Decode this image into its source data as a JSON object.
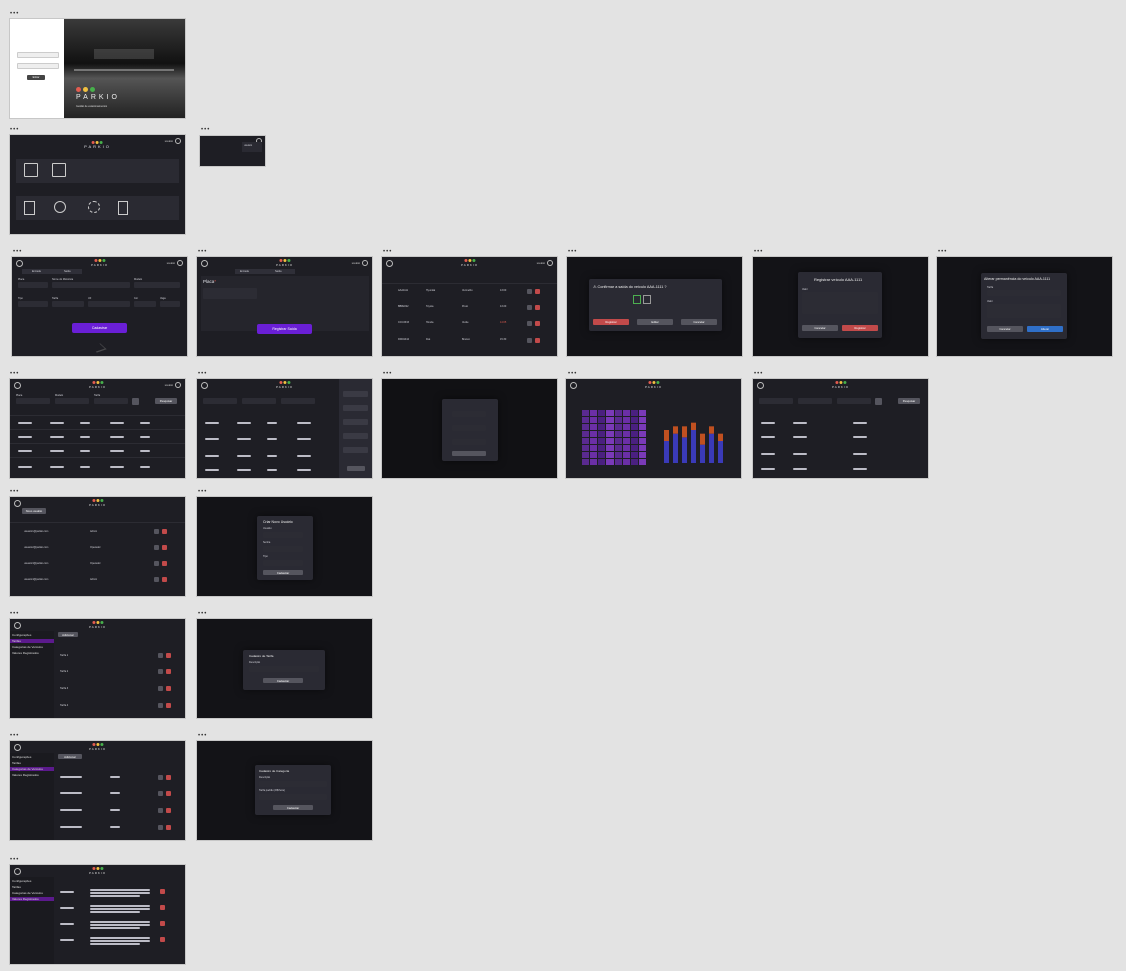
{
  "frame_menu_glyph": "•••",
  "login": {
    "brand": "PARKIO",
    "tagline": "Gestão de estacionamentos",
    "button": "Entrar"
  },
  "menu": {
    "brand": "PARKIO"
  },
  "user": {
    "name": "usuário"
  },
  "entrada": {
    "tabs": [
      "Entrada",
      "Saída"
    ],
    "fields": [
      "Placa",
      "Nome do Motorista",
      "Modelo",
      "Tipo",
      "Tarifa",
      "UF",
      "Cor",
      "Vaga"
    ],
    "button": "Cadastrar"
  },
  "saida": {
    "tabs": [
      "Entrada",
      "Saída"
    ],
    "placa_label": "Placa",
    "required": "*",
    "button": "Registrar Saída"
  },
  "veiculos_table": {
    "rows": [
      [
        "AAA1111",
        "Hyundai",
        "Vermelho",
        "13:00"
      ],
      [
        "BBB2222",
        "Toyota",
        "Preto",
        "13:20"
      ],
      [
        "CCC3333",
        "Honda",
        "Verde",
        "14:05"
      ],
      [
        "DDD4444",
        "Fiat",
        "Branco",
        "15:30"
      ]
    ]
  },
  "confirm_modal": {
    "title": "Confirmar a saída do veículo AAA-1111 ?",
    "buttons": [
      "Registrar",
      "Editar",
      "Cancelar"
    ]
  },
  "registrar_modal": {
    "title": "Registrar veículo AAA-1111",
    "field": "Valor",
    "buttons": [
      "Cancelar",
      "Registrar"
    ]
  },
  "alterar_modal": {
    "title": "Alterar permanência do veículo AAA-1111",
    "fields": [
      "Tarifa",
      "Valor"
    ],
    "buttons": [
      "Cancelar",
      "Alterar"
    ]
  },
  "relatorio": {
    "filters": [
      "Placa",
      "Modelo",
      "Tarifa"
    ],
    "search_button": "Pesquisar",
    "filter_icon": "funnel-icon"
  },
  "usuarios": {
    "add_button": "Novo usuário",
    "rows": [
      "usuario1@parkio.com",
      "usuario2@parkio.com",
      "usuario3@parkio.com",
      "usuario4@parkio.com"
    ],
    "roles": [
      "Admin",
      "Operador",
      "Operador",
      "Admin"
    ],
    "modal_title": "Criar Novo Usuário",
    "modal_fields": [
      "Usuário",
      "Senha",
      "Tipo"
    ],
    "modal_button": "Cadastrar"
  },
  "config": {
    "side_title": "Configurações",
    "side_items": [
      "Tarifas",
      "Categorias de Veículos",
      "Valores Registrados"
    ],
    "add_button": "Adicionar",
    "tarifa_rows": [
      "Tarifa 1",
      "Tarifa 2",
      "Tarifa 3",
      "Tarifa 4"
    ],
    "modal_title": "Cadastro de Tarifa",
    "modal_field": "Descrição",
    "modal_button": "Cadastrar",
    "cat_modal_title": "Cadastro de Categoria",
    "cat_modal_fields": [
      "Descrição",
      "Tarifa padrão (R$/hora)"
    ]
  },
  "colors": {
    "accent": "#6a1fd6",
    "danger": "#c24a4a",
    "bg": "#1e1e24",
    "canvas": "#e3e3e3"
  },
  "chart_data": {
    "type": "bar",
    "series": [
      {
        "values": [
          6,
          8,
          7,
          9,
          5,
          8,
          6
        ]
      },
      {
        "values": [
          3,
          2,
          3,
          2,
          3,
          2,
          2
        ]
      }
    ],
    "colors": [
      "#3a3ab8",
      "#c05020"
    ]
  }
}
